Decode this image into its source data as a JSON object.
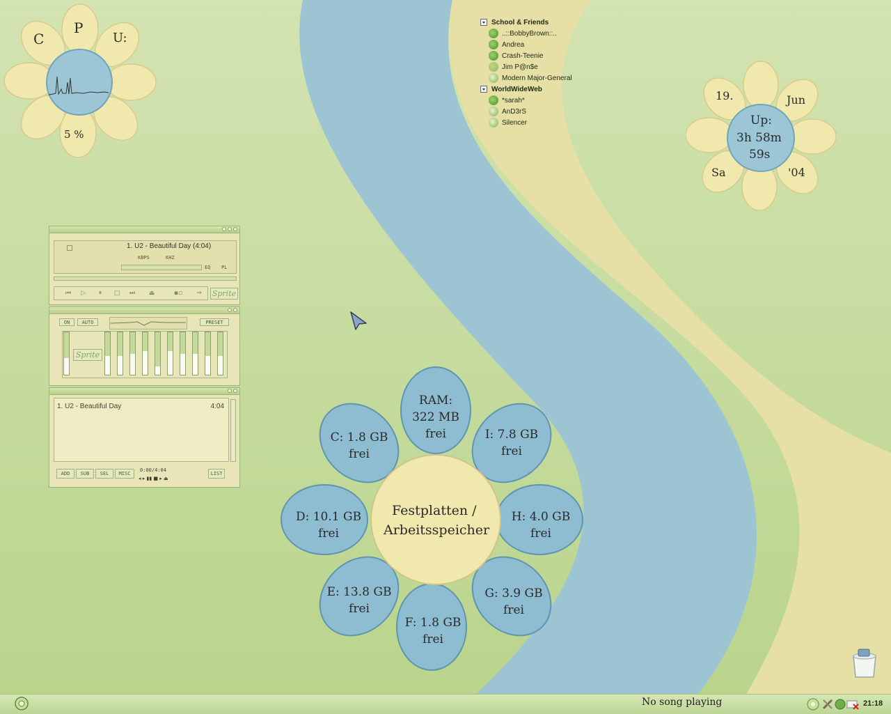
{
  "cpu_flower": {
    "letters": [
      "C",
      "P",
      "U:"
    ],
    "percent": "5 %"
  },
  "uptime_flower": {
    "day": "19.",
    "month": "Jun",
    "weekday": "Sa",
    "year": "'04",
    "label": "Up:",
    "hours_minutes": "3h 58m",
    "seconds": "59s"
  },
  "drives_flower": {
    "center_line1": "Festplatten /",
    "center_line2": "Arbeitsspeicher",
    "petals": [
      {
        "line1": "RAM:",
        "line2": "322 MB",
        "line3": "frei"
      },
      {
        "line1": "I: 7.8 GB",
        "line2": "frei"
      },
      {
        "line1": "H: 4.0 GB",
        "line2": "frei"
      },
      {
        "line1": "G: 3.9 GB",
        "line2": "frei"
      },
      {
        "line1": "F: 1.8 GB",
        "line2": "frei"
      },
      {
        "line1": "E: 13.8 GB",
        "line2": "frei"
      },
      {
        "line1": "D: 10.1 GB",
        "line2": "frei"
      },
      {
        "line1": "C: 1.8 GB",
        "line2": "frei"
      }
    ]
  },
  "buddy_list": {
    "groups": [
      {
        "name": "School & Friends",
        "buddies": [
          {
            "name": "..::BobbyBrown::..",
            "status": "online"
          },
          {
            "name": "Andrea",
            "status": "online"
          },
          {
            "name": "Crash-Teenie",
            "status": "online"
          },
          {
            "name": "Jim P@n$e",
            "status": "away"
          },
          {
            "name": "Modern Major-General",
            "status": "online"
          }
        ]
      },
      {
        "name": "WorldWideWeb",
        "buddies": [
          {
            "name": "*sarah*",
            "status": "online"
          },
          {
            "name": "AnD3rS",
            "status": "online"
          },
          {
            "name": "Silencer",
            "status": "online"
          }
        ]
      }
    ]
  },
  "winamp": {
    "main": {
      "title": "1. U2 - Beautiful Day (4:04)",
      "kbps_label": "KBPS",
      "khz_label": "KHZ",
      "eq_label": "EQ",
      "pl_label": "PL",
      "skin_name": "Sprite"
    },
    "equalizer": {
      "on_label": "ON",
      "auto_label": "AUTO",
      "preset_label": "PRESET",
      "skin_name": "Sprite",
      "preamp": 0.4,
      "bands": [
        0.45,
        0.45,
        0.5,
        0.55,
        0.2,
        0.55,
        0.5,
        0.5,
        0.45,
        0.45
      ]
    },
    "playlist": {
      "track": "1. U2 - Beautiful Day",
      "duration": "4:04",
      "time": "0:00/4:04",
      "buttons": [
        "ADD",
        "SUB",
        "SEL",
        "MISC"
      ],
      "list_label": "LIST"
    }
  },
  "taskbar": {
    "now_playing": "No song playing",
    "clock": "21:18"
  },
  "colors": {
    "wall_green": "#c7dca0",
    "river_blue": "#9cc4d2",
    "path_yellow": "#e6e0a6",
    "petal_yellow": "#f1e8ad",
    "petal_blue": "#8ebcd1"
  }
}
